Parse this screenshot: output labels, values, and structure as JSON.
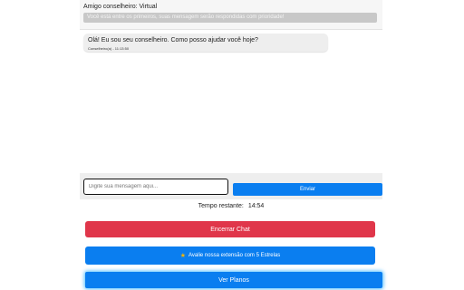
{
  "header": {
    "advisor_title": "Amigo conselheiro: Virtual",
    "priority_banner": "Você está entre os primeiros, suas mensagem serão respondidas com prioridade!"
  },
  "messages": [
    {
      "text": "Olá! Eu sou seu conselheiro. Como posso ajudar você hoje?",
      "meta": "Conselheiro(a) - 11:13:50"
    }
  ],
  "composer": {
    "placeholder": "Digite sua mensagem aqui...",
    "value": "",
    "send_label": "Enviar"
  },
  "timer": {
    "label": "Tempo restante:",
    "value": "14:54"
  },
  "buttons": {
    "end_chat": "Encerrar Chat",
    "rate": "Avalie nossa extensão com 5 Estrelas",
    "plans": "Ver Planos"
  },
  "icons": {
    "rate": "star-icon"
  },
  "colors": {
    "primary": "#0a7ef0",
    "danger": "#e0364a",
    "banner": "#c8c8c8"
  }
}
